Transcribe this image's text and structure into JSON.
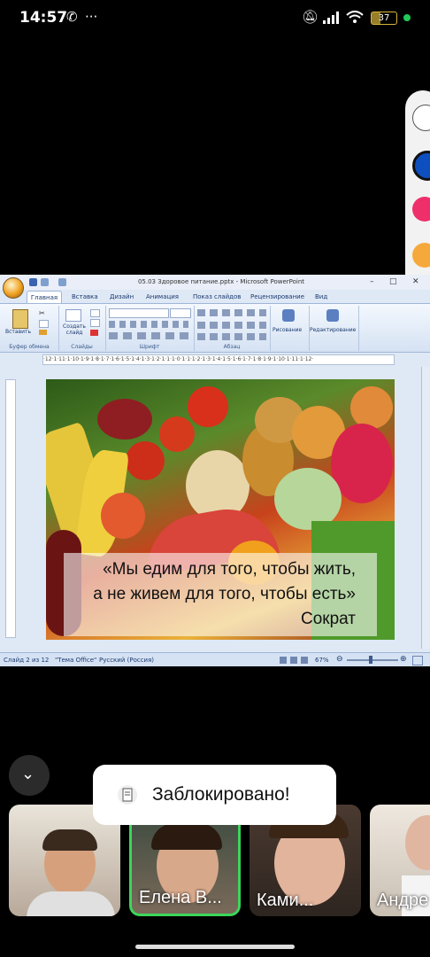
{
  "status_bar": {
    "time": "14:57",
    "battery": "37"
  },
  "powerpoint": {
    "title": "05.03 Здоровое питание.pptx - Microsoft PowerPoint",
    "tabs": [
      "Главная",
      "Вставка",
      "Дизайн",
      "Анимация",
      "Показ слайдов",
      "Рецензирование",
      "Вид"
    ],
    "ribbon": {
      "paste_label": "Вставить",
      "new_slide_label": "Создать слайд",
      "drawing_label": "Рисование",
      "editing_label": "Редактирование",
      "groups": [
        "Буфер обмена",
        "Слайды",
        "Шрифт",
        "Абзац"
      ]
    },
    "ruler": "·12·1·11·1·10·1·9·1·8·1·7·1·6·1·5·1·4·1·3·1·2·1·1·1·0·1·1·1·2·1·3·1·4·1·5·1·6·1·7·1·8·1·9·1·10·1·11·1·12·",
    "slide": {
      "quote_line1": "«Мы едим для того, чтобы жить,",
      "quote_line2": "а не живем для того, чтобы есть»",
      "author": "Сократ"
    },
    "status": {
      "slide_counter": "Слайд 2 из 12",
      "theme": "\"Тема Office\"",
      "language": "Русский (Россия)",
      "zoom": "67%"
    }
  },
  "toast": {
    "text": "Заблокировано!"
  },
  "participants": [
    {
      "name": ""
    },
    {
      "name": "Елена В..."
    },
    {
      "name": "Ками..."
    },
    {
      "name": "Андре"
    }
  ],
  "colors": {
    "speaking_border": "#3cd65a",
    "battery": "#d9b43a"
  }
}
